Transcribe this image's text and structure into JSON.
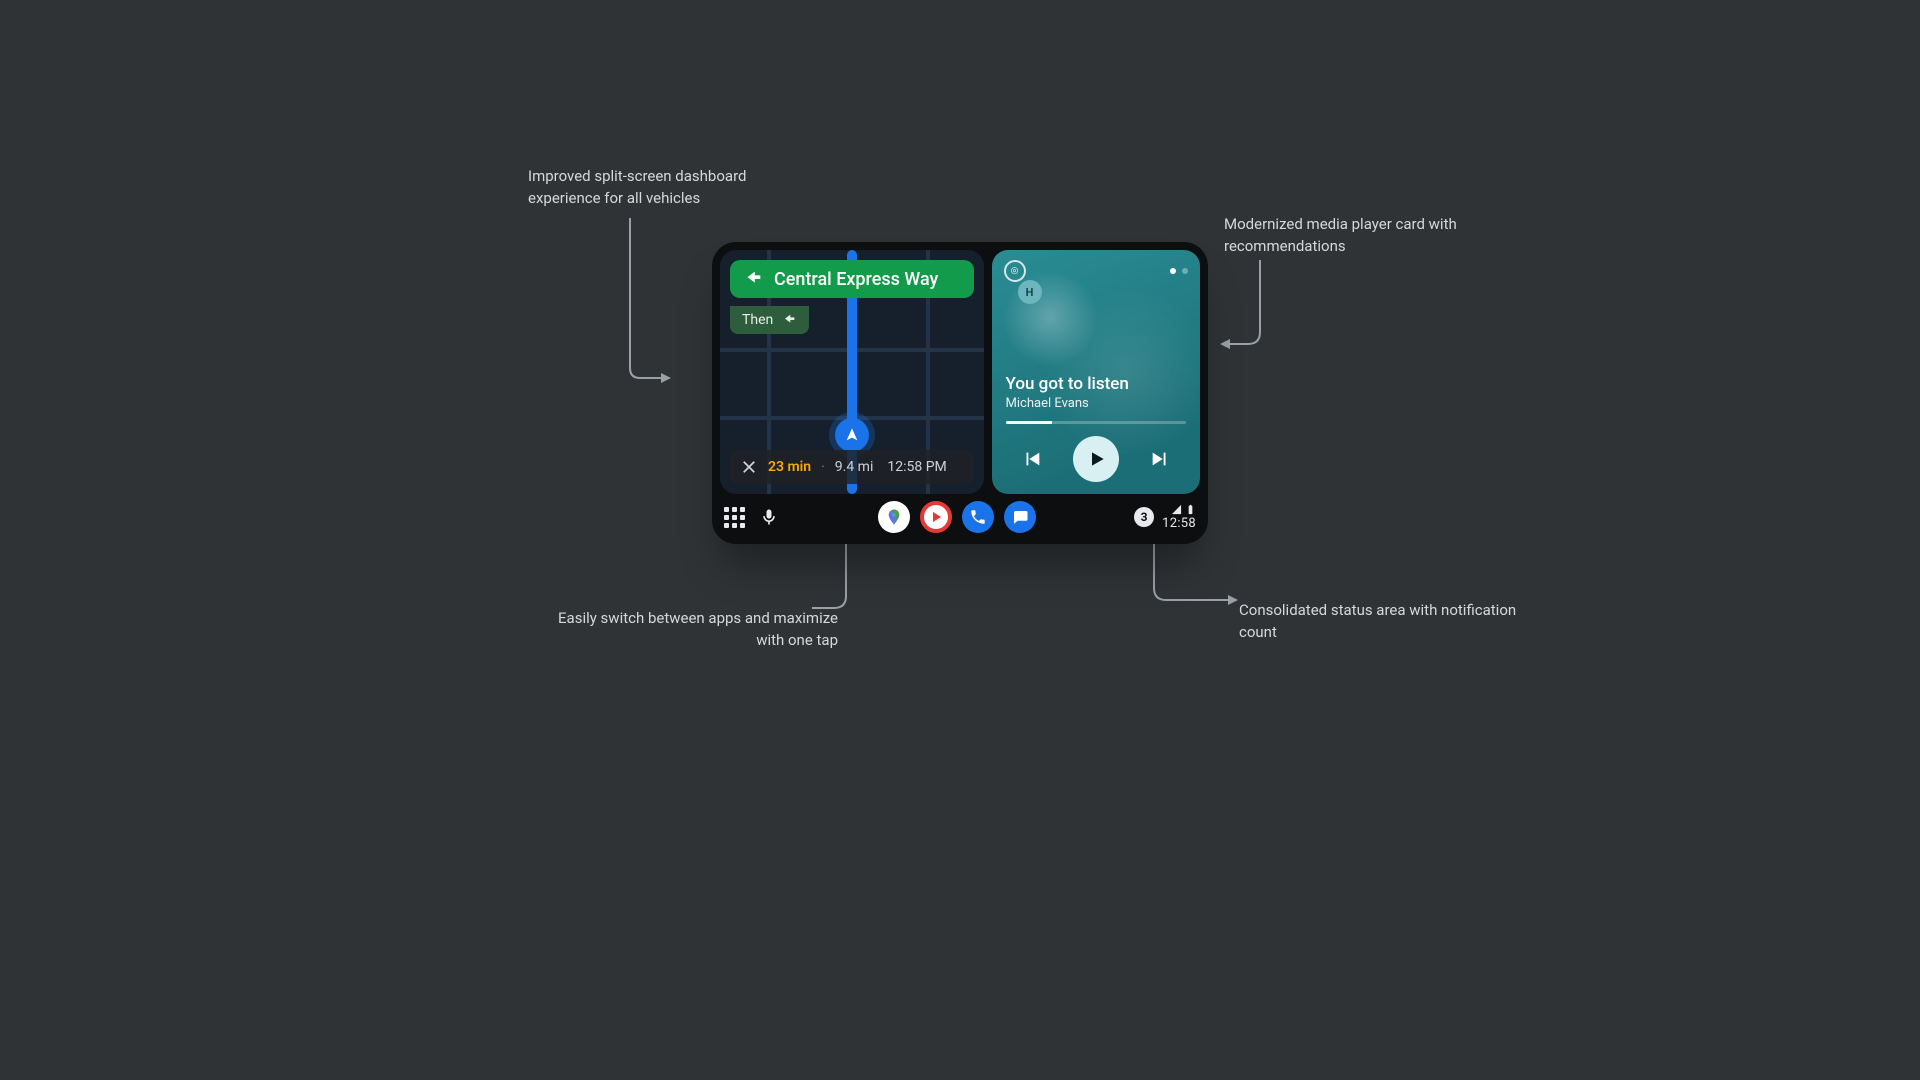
{
  "annotations": {
    "top_left": "Improved split-screen dashboard experience for all vehicles",
    "top_right": "Modernized media player card with recommendations",
    "bottom_left": "Easily switch between apps and maximize with one tap",
    "bottom_right": "Consolidated status area with notification count"
  },
  "navigation": {
    "direction_road": "Central Express Way",
    "then_label": "Then",
    "eta": {
      "duration": "23 min",
      "distance": "9.4 mi",
      "arrival": "12:58 PM"
    }
  },
  "media": {
    "source_initial": "◎",
    "avatar_initial": "H",
    "title": "You got to listen",
    "artist": "Michael Evans",
    "progress_pct": 26,
    "pager_index": 0,
    "pager_count": 2
  },
  "statusbar": {
    "notification_count": "3",
    "time": "12:58"
  },
  "dock_apps": [
    "maps",
    "youtube-music",
    "phone",
    "messages"
  ]
}
